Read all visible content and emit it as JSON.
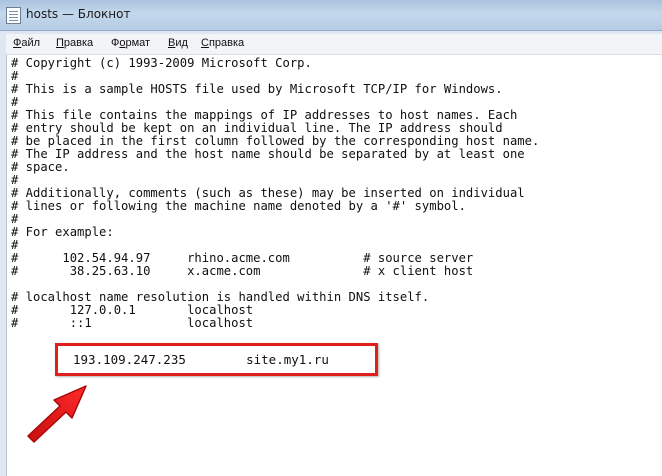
{
  "window": {
    "title": "hosts — Блокнот",
    "icon": "notepad-icon"
  },
  "menu": {
    "items": [
      {
        "mnemonic": "Ф",
        "rest": "айл"
      },
      {
        "mnemonic": "П",
        "rest": "равка"
      },
      {
        "mnemonic": "",
        "rest": "Формат",
        "display_mnemonic": "о",
        "pre": "Ф",
        "post": "рмат"
      },
      {
        "mnemonic": "В",
        "rest": "ид"
      },
      {
        "mnemonic": "С",
        "rest": "правка"
      }
    ],
    "labels": [
      "Файл",
      "Правка",
      "Формат",
      "Вид",
      "Справка"
    ]
  },
  "content": {
    "lines": [
      "# Copyright (c) 1993-2009 Microsoft Corp.",
      "#",
      "# This is a sample HOSTS file used by Microsoft TCP/IP for Windows.",
      "#",
      "# This file contains the mappings of IP addresses to host names. Each",
      "# entry should be kept on an individual line. The IP address should",
      "# be placed in the first column followed by the corresponding host name.",
      "# The IP address and the host name should be separated by at least one",
      "# space.",
      "#",
      "# Additionally, comments (such as these) may be inserted on individual",
      "# lines or following the machine name denoted by a '#' symbol.",
      "#",
      "# For example:",
      "#",
      "#      102.54.94.97     rhino.acme.com          # source server",
      "#       38.25.63.10     x.acme.com              # x client host",
      "",
      "# localhost name resolution is handled within DNS itself.",
      "#       127.0.0.1       localhost",
      "#       ::1             localhost"
    ],
    "added_entry": "193.109.247.235        site.my1.ru"
  },
  "annotations": {
    "highlight_color": "#e01e1e",
    "arrow_color": "#e01e1e"
  }
}
